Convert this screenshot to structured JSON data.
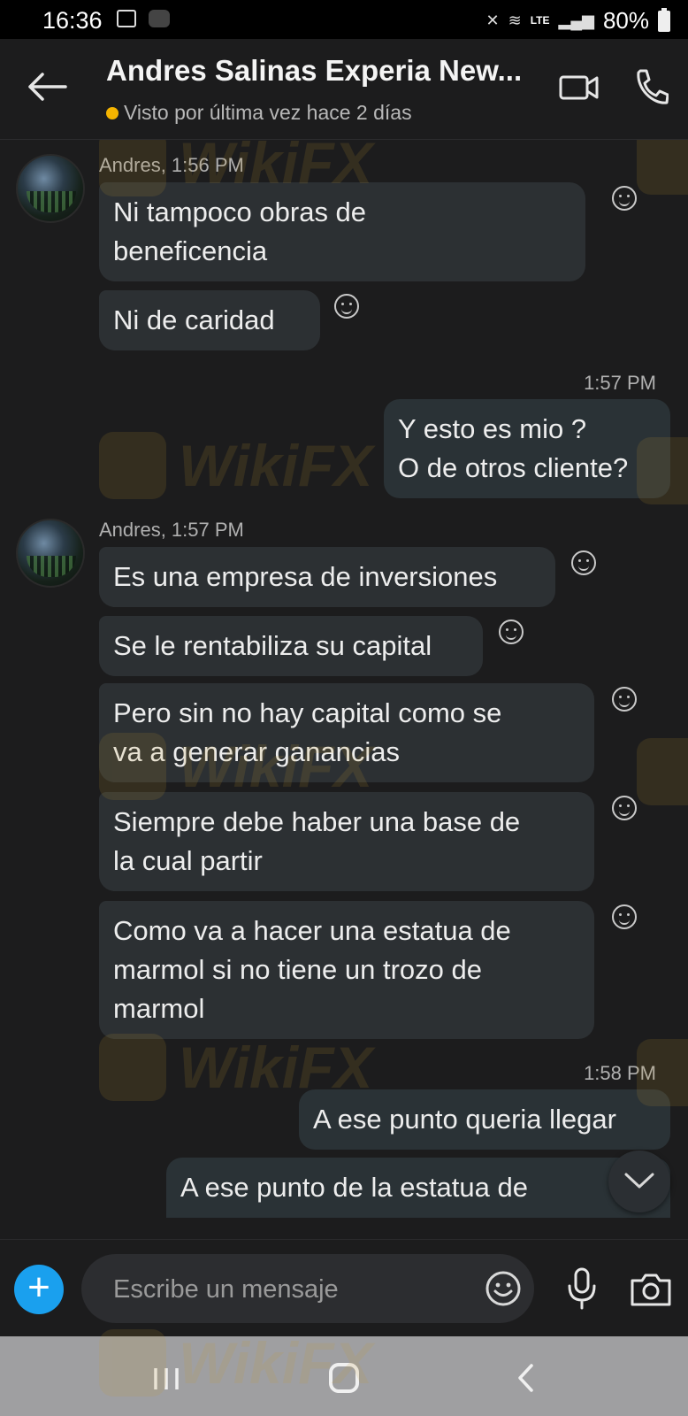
{
  "status_bar": {
    "time": "16:36",
    "network": "LTE",
    "battery": "80%"
  },
  "header": {
    "contact_name": "Andres Salinas Experia New...",
    "presence_text": "Visto por última vez hace 2 días",
    "presence_color": "#f5b400"
  },
  "messages": {
    "group1": {
      "meta": "Andres, 1:56 PM",
      "bubbles": [
        "Ni tampoco obras de\nbeneficencia",
        "Ni de caridad"
      ]
    },
    "out1": {
      "time": "1:57 PM",
      "text": "Y esto es mio ?\nO de otros cliente?"
    },
    "group2": {
      "meta": "Andres, 1:57 PM",
      "bubbles": [
        "Es una empresa de inversiones",
        "Se le rentabiliza su capital",
        "Pero sin no hay capital como se\nva a generar ganancias",
        "Siempre debe haber una base de\nla cual partir",
        "Como va a hacer una estatua de\nmarmol si no tiene un trozo de\nmarmol"
      ]
    },
    "out2": {
      "time": "1:58 PM",
      "bubbles": [
        "A ese punto queria llegar",
        "A ese punto de la estatua de"
      ]
    }
  },
  "composer": {
    "placeholder": "Escribe un mensaje"
  },
  "watermark_text": "WikiFX",
  "icons": {
    "back": "back-arrow-icon",
    "video": "video-call-icon",
    "phone": "phone-call-icon",
    "reaction": "smiley-icon",
    "scroll": "chevron-down-icon",
    "plus": "plus-icon",
    "emoji": "emoji-icon",
    "mic": "microphone-icon",
    "camera": "camera-icon"
  },
  "colors": {
    "accent": "#1aa0ee",
    "bubble": "#2c3033",
    "background": "#1c1c1d"
  }
}
